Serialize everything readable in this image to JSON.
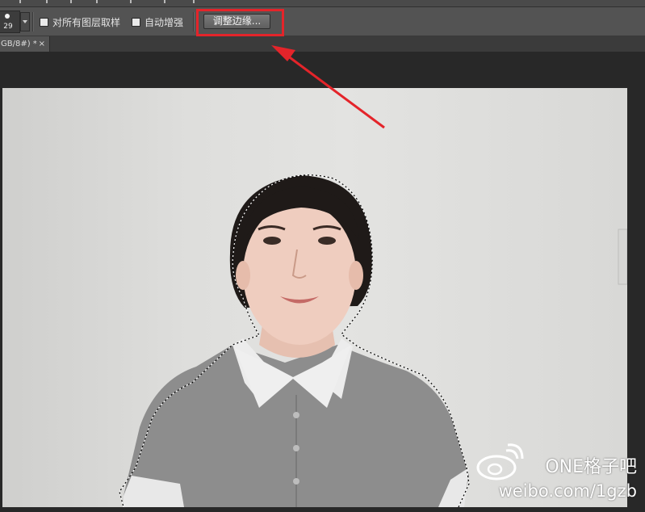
{
  "options_bar": {
    "brush_size": "29",
    "sample_all_layers_label": "对所有图层取样",
    "auto_enhance_label": "自动增强",
    "refine_edge_label": "调整边缘..."
  },
  "document_tab": {
    "title": "GB/8#) *",
    "close_glyph": "×"
  },
  "watermark": {
    "brand": "ONE格子吧",
    "url": "weibo.com/1gzb"
  },
  "colors": {
    "highlight": "#e4242a",
    "panel": "#535353",
    "workspace": "#282828"
  }
}
